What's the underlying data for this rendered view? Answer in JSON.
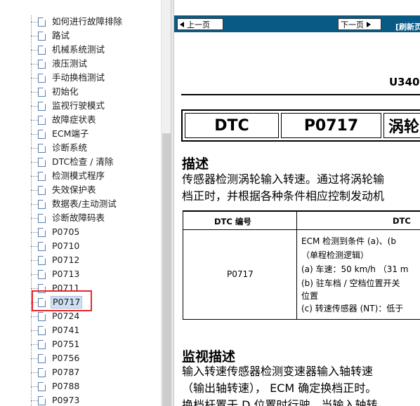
{
  "tree": {
    "items": [
      {
        "label": "如何进行故障排除",
        "selected": false
      },
      {
        "label": "路试",
        "selected": false
      },
      {
        "label": "机械系统测试",
        "selected": false
      },
      {
        "label": "液压测试",
        "selected": false
      },
      {
        "label": "手动换档测试",
        "selected": false
      },
      {
        "label": "初始化",
        "selected": false
      },
      {
        "label": "监视行驶模式",
        "selected": false
      },
      {
        "label": "故障症状表",
        "selected": false
      },
      {
        "label": "ECM端子",
        "selected": false
      },
      {
        "label": "诊断系统",
        "selected": false
      },
      {
        "label": "DTC检查 / 清除",
        "selected": false
      },
      {
        "label": "检测模式程序",
        "selected": false
      },
      {
        "label": "失效保护表",
        "selected": false
      },
      {
        "label": "数据表/主动测试",
        "selected": false
      },
      {
        "label": "诊断故障码表",
        "selected": false
      },
      {
        "label": "P0705",
        "selected": false
      },
      {
        "label": "P0710",
        "selected": false
      },
      {
        "label": "P0712",
        "selected": false
      },
      {
        "label": "P0713",
        "selected": false
      },
      {
        "label": "P0711",
        "selected": false
      },
      {
        "label": "P0717",
        "selected": true
      },
      {
        "label": "P0724",
        "selected": false
      },
      {
        "label": "P0741",
        "selected": false
      },
      {
        "label": "P0751",
        "selected": false
      },
      {
        "label": "P0756",
        "selected": false
      },
      {
        "label": "P0787",
        "selected": false
      },
      {
        "label": "P0788",
        "selected": false
      },
      {
        "label": "P0973",
        "selected": false
      }
    ]
  },
  "nav": {
    "prev_label": "上一页",
    "next_label": "下一页",
    "refresh_label": "[刷新页"
  },
  "doc": {
    "page_code": "U340",
    "header": {
      "cell1": "DTC",
      "cell2": "P0717",
      "cell3": "涡轮"
    },
    "section1_title": "描述",
    "section1_lines": [
      "传感器检测涡轮输入转速。通过将涡轮输",
      "档正时，并根据各种条件相应控制发动机"
    ],
    "table": {
      "col1_header": "DTC 编号",
      "col2_header": "DTC",
      "code": "P0717",
      "conditions": [
        "ECM 检测到条件 (a)、(b",
        "（单程检测逻辑）",
        "(a) 车速：50 km/h （31 m",
        "(b) 驻车档 / 空档位置开关",
        "位置",
        "(c) 转速传感器 (NT)：低于"
      ]
    },
    "section2_title": "监视描述",
    "section2_lines": [
      "输入转速传感器检测变速器输入轴转速",
      "（输出轴转速）， ECM 确定换档正时。",
      "换档杆置于 D 位置时行驶，当输入轴转"
    ]
  },
  "colors": {
    "nav_bar": "#0a5a86",
    "selection": "#cfe0f2",
    "highlight_box": "#e8262b"
  }
}
